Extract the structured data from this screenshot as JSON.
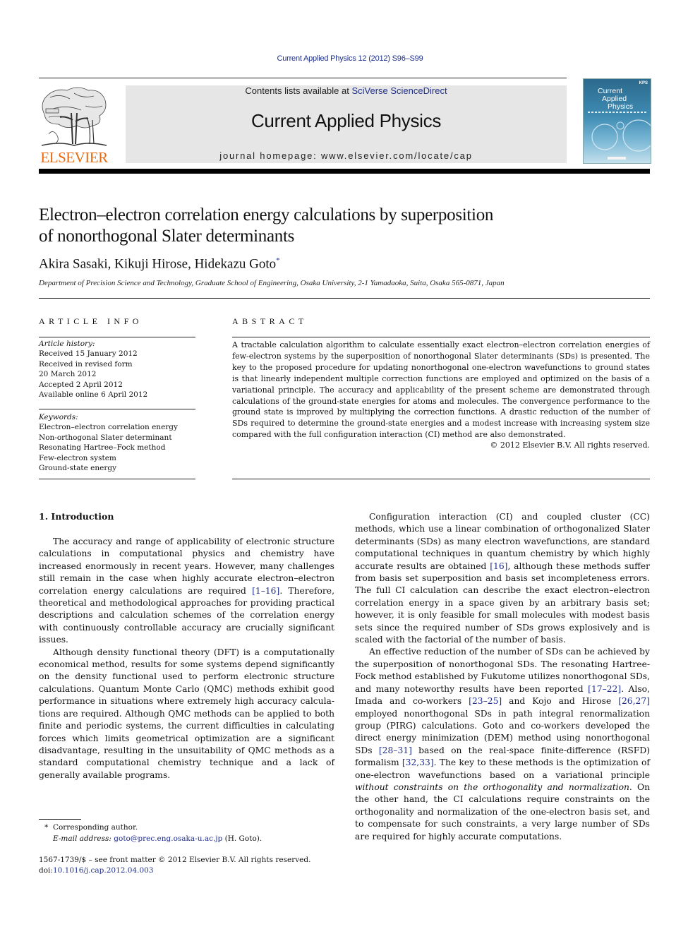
{
  "journal_ref": "Current Applied Physics 12 (2012) S96–S99",
  "header": {
    "contents_prefix": "Contents lists available at ",
    "contents_link": "SciVerse ScienceDirect",
    "journal_title": "Current Applied Physics",
    "homepage": "journal homepage: www.elsevier.com/locate/cap",
    "publisher_logo_text": "ELSEVIER",
    "cover": {
      "title_lines": [
        "Current",
        "Applied",
        "Physics"
      ],
      "badge": "KPS"
    }
  },
  "article": {
    "title_line1": "Electron–electron correlation energy calculations by superposition",
    "title_line2": "of nonorthogonal Slater determinants",
    "authors": "Akira Sasaki, Kikuji Hirose, Hidekazu Goto",
    "author_mark": "*",
    "affiliation": "Department of Precision Science and Technology, Graduate School of Engineering, Osaka University, 2-1 Yamadaoka, Suita, Osaka 565-0871, Japan"
  },
  "article_info": {
    "heading": "ARTICLE INFO",
    "history_label": "Article history:",
    "history": [
      "Received 15 January 2012",
      "Received in revised form",
      "20 March 2012",
      "Accepted 2 April 2012",
      "Available online 6 April 2012"
    ],
    "keywords_label": "Keywords:",
    "keywords": [
      "Electron–electron correlation energy",
      "Non-orthogonal Slater determinant",
      "Resonating Hartree–Fock method",
      "Few-electron system",
      "Ground-state energy"
    ]
  },
  "abstract": {
    "heading": "ABSTRACT",
    "text": "A tractable calculation algorithm to calculate essentially exact electron–electron correlation energies of few-electron systems by the superposition of nonorthogonal Slater determinants (SDs) is presented. The key to the proposed procedure for updating nonorthogonal one-electron wavefunctions to ground states is that linearly independent multiple correction functions are employed and optimized on the basis of a variational principle. The accuracy and applicability of the present scheme are demonstrated through calculations of the ground-state energies for atoms and molecules. The convergence performance to the ground state is improved by multiplying the correction functions. A drastic reduction of the number of SDs required to determine the ground-state energies and a modest increase with increasing system size compared with the full configuration interaction (CI) method are also demonstrated.",
    "copyright": "© 2012 Elsevier B.V. All rights reserved."
  },
  "introduction": {
    "heading": "1.  Introduction",
    "p1": {
      "a": "The accuracy and range of applicability of electronic structure calculations in computational physics and chemistry have increased enormously in recent years. However, many challenges still remain in the case when highly accurate electron–electron correlation energy calculations are required ",
      "ref1": "[1–16]",
      "b": ". Therefore, theoretical and methodological approaches for providing practical descriptions and calculation schemes of the correlation energy with continuously controllable accuracy are crucially significant issues."
    },
    "p2": "Although density functional theory (DFT) is a computationally economical method, results for some systems depend significantly on the density functional used to perform electronic structure calculations. Quantum Monte Carlo (QMC) methods exhibit good performance in situations where extremely high accuracy calcula­tions are required. Although QMC methods can be applied to both finite and periodic systems, the current difficulties in calculating forces which limits geometrical optimization are a significant disadvantage, resulting in the unsuitability of QMC methods as a standard computational chemistry technique and a lack of generally available programs.",
    "p3": {
      "a": "Configuration interaction (CI) and coupled cluster (CC) methods, which use a linear combination of orthogonalized Slater determi­nants (SDs) as many electron wavefunctions, are standard compu­tational techniques in quantum chemistry by which highly accurate results are obtained ",
      "ref1": "[16]",
      "b": ", although these methods suffer from basis set superposition and basis set incompleteness errors. The full CI calculation can describe the exact electron–electron correlation energy in a space given by an arbitrary basis set; however, it is only feasible for small molecules with modest basis sets since the required number of SDs grows explosively and is scaled with the factorial of the number of basis."
    },
    "p4": {
      "a": "An effective reduction of the number of SDs can be achieved by the superposition of nonorthogonal SDs. The resonating Hartree-Fock method established by Fukutome utilizes nonorthogonal SDs, and many noteworthy results have been reported ",
      "ref1": "[17–22]",
      "b": ". Also, Imada and co-workers ",
      "ref2": "[23–25]",
      "c": " and Kojo and Hirose ",
      "ref3": "[26,27]",
      "d": " employed nonorthogonal SDs in path integral renormalization group (PIRG) calculations. Goto and co-workers developed the direct energy minimization (DEM) method using nonorthogonal SDs ",
      "ref4": "[28–31]",
      "e": " based on the real-space finite-difference (RSFD) formalism ",
      "ref5": "[32,33]",
      "f": ". The key to these methods is the optimization of one-electron wavefunctions based on a variational principle ",
      "italic": "without constraints on the orthogonality and normalization",
      "g": ". On the other hand, the CI calculations require constraints on the orthog­onality and normalization of the one-electron basis set, and to compensate for such constraints, a very large number of SDs are required for highly accurate computations."
    }
  },
  "footnote": {
    "mark": "*",
    "corresponding": "Corresponding author.",
    "email_label": "E-mail address:",
    "email": "goto@prec.eng.osaka-u.ac.jp",
    "email_suffix": " (H. Goto)."
  },
  "front_matter": {
    "issn_line": "1567-1739/$ – see front matter © 2012 Elsevier B.V. All rights reserved.",
    "doi_prefix": "doi:",
    "doi": "10.1016/j.cap.2012.04.003"
  },
  "colors": {
    "link": "#1f2f8c",
    "elsevier_orange": "#e86a10",
    "header_gray": "#e6e6e6"
  }
}
